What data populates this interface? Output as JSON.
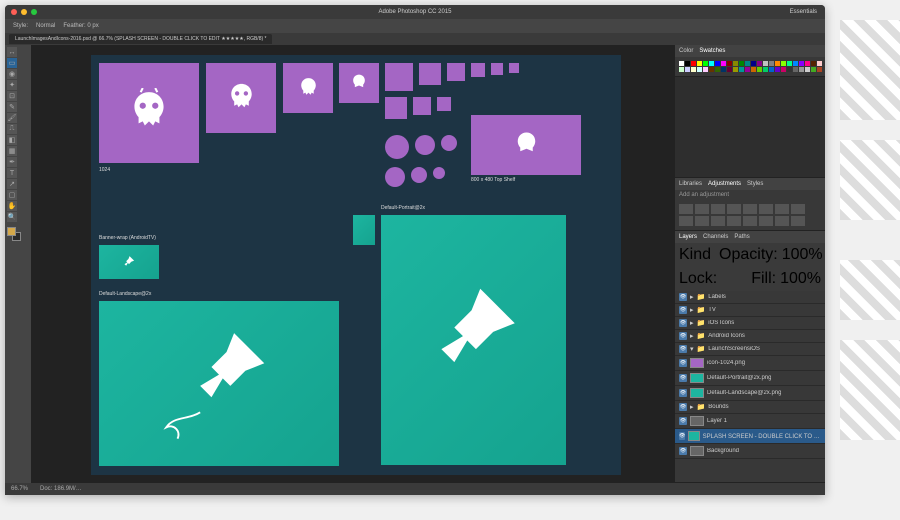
{
  "app": {
    "title": "Adobe Photoshop CC 2015",
    "essentials": "Essentials"
  },
  "menubar": {
    "style": "Style:",
    "normal": "Normal",
    "feather": "Feather: 0 px"
  },
  "tab": {
    "label": "LaunchImagesAndIcons-2016.psd @ 66.7% (SPLASH SCREEN - DOUBLE CLICK TO EDIT ★★★★★, RGB/8) *"
  },
  "panels": {
    "color": "Color",
    "swatches": "Swatches",
    "libraries": "Libraries",
    "adjustments": "Adjustments",
    "styles": "Styles",
    "addadj": "Add an adjustment",
    "layers": "Layers",
    "channels": "Channels",
    "paths": "Paths",
    "kind": "Kind",
    "opacity": "Opacity:",
    "opacity_val": "100%",
    "lock": "Lock:",
    "fill": "Fill:",
    "fill_val": "100%"
  },
  "layers": [
    {
      "name": "Labels",
      "type": "folder"
    },
    {
      "name": "TV",
      "type": "folder"
    },
    {
      "name": "iOS Icons",
      "type": "folder"
    },
    {
      "name": "Android Icons",
      "type": "folder"
    },
    {
      "name": "LaunchScreensiOS",
      "type": "folder",
      "open": true
    },
    {
      "name": "icon-1024.png",
      "type": "layer",
      "thumb": "purple"
    },
    {
      "name": "Default-Portrait@2x.png",
      "type": "layer",
      "thumb": "teal"
    },
    {
      "name": "Default-Landscape@2x.png",
      "type": "layer",
      "thumb": "teal"
    },
    {
      "name": "Bounds",
      "type": "folder"
    },
    {
      "name": "Layer 1",
      "type": "layer",
      "thumb": ""
    },
    {
      "name": "SPLASH SCREEN - DOUBLE CLICK TO EDIT ★★★★★",
      "type": "layer",
      "thumb": "teal",
      "selected": true
    },
    {
      "name": "Background",
      "type": "layer",
      "thumb": ""
    }
  ],
  "canvas_labels": {
    "banner": "Banner-wrap (AndroidTV)",
    "default_landscape": "Default-Landscape@2x",
    "default_portrait": "Default-Portrait@2x",
    "large": "1024",
    "top_shelf": "800 x 480 Top Shelf"
  },
  "status": {
    "zoom": "66.7%",
    "doc": "Doc: 186.9M/…"
  },
  "swatches_colors": [
    "#ffffff",
    "#000000",
    "#ff0000",
    "#ffff00",
    "#00ff00",
    "#00ffff",
    "#0000ff",
    "#ff00ff",
    "#880000",
    "#888800",
    "#008800",
    "#008888",
    "#000088",
    "#880088",
    "#c0c0c0",
    "#808080",
    "#ff8800",
    "#88ff00",
    "#00ff88",
    "#0088ff",
    "#8800ff",
    "#ff0088",
    "#552200",
    "#ffcccc",
    "#ccffcc",
    "#ccccff",
    "#ffffcc",
    "#ccffff",
    "#ffccff",
    "#663300",
    "#336600",
    "#003366",
    "#660033",
    "#999900",
    "#009999",
    "#990099",
    "#cc6600",
    "#66cc00",
    "#00cc66",
    "#0066cc",
    "#6600cc",
    "#cc0066",
    "#333333",
    "#666666",
    "#999999",
    "#cccccc",
    "#4a2",
    "#a42"
  ]
}
